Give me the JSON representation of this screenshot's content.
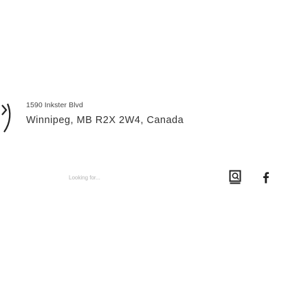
{
  "footer": {
    "address": {
      "line1": "1590 Inkster Blvd",
      "line2": "Winnipeg, MB R2X 2W4, Canada"
    },
    "search": {
      "placeholder": "Looking for...",
      "value": "",
      "button_icon": "search-icon"
    },
    "social": {
      "facebook_icon": "facebook-icon"
    },
    "brand_icon": "logo-arc-icon"
  },
  "colors": {
    "text_primary": "#333333",
    "placeholder": "#b3b3b3",
    "icon": "#222222",
    "background": "#ffffff"
  }
}
